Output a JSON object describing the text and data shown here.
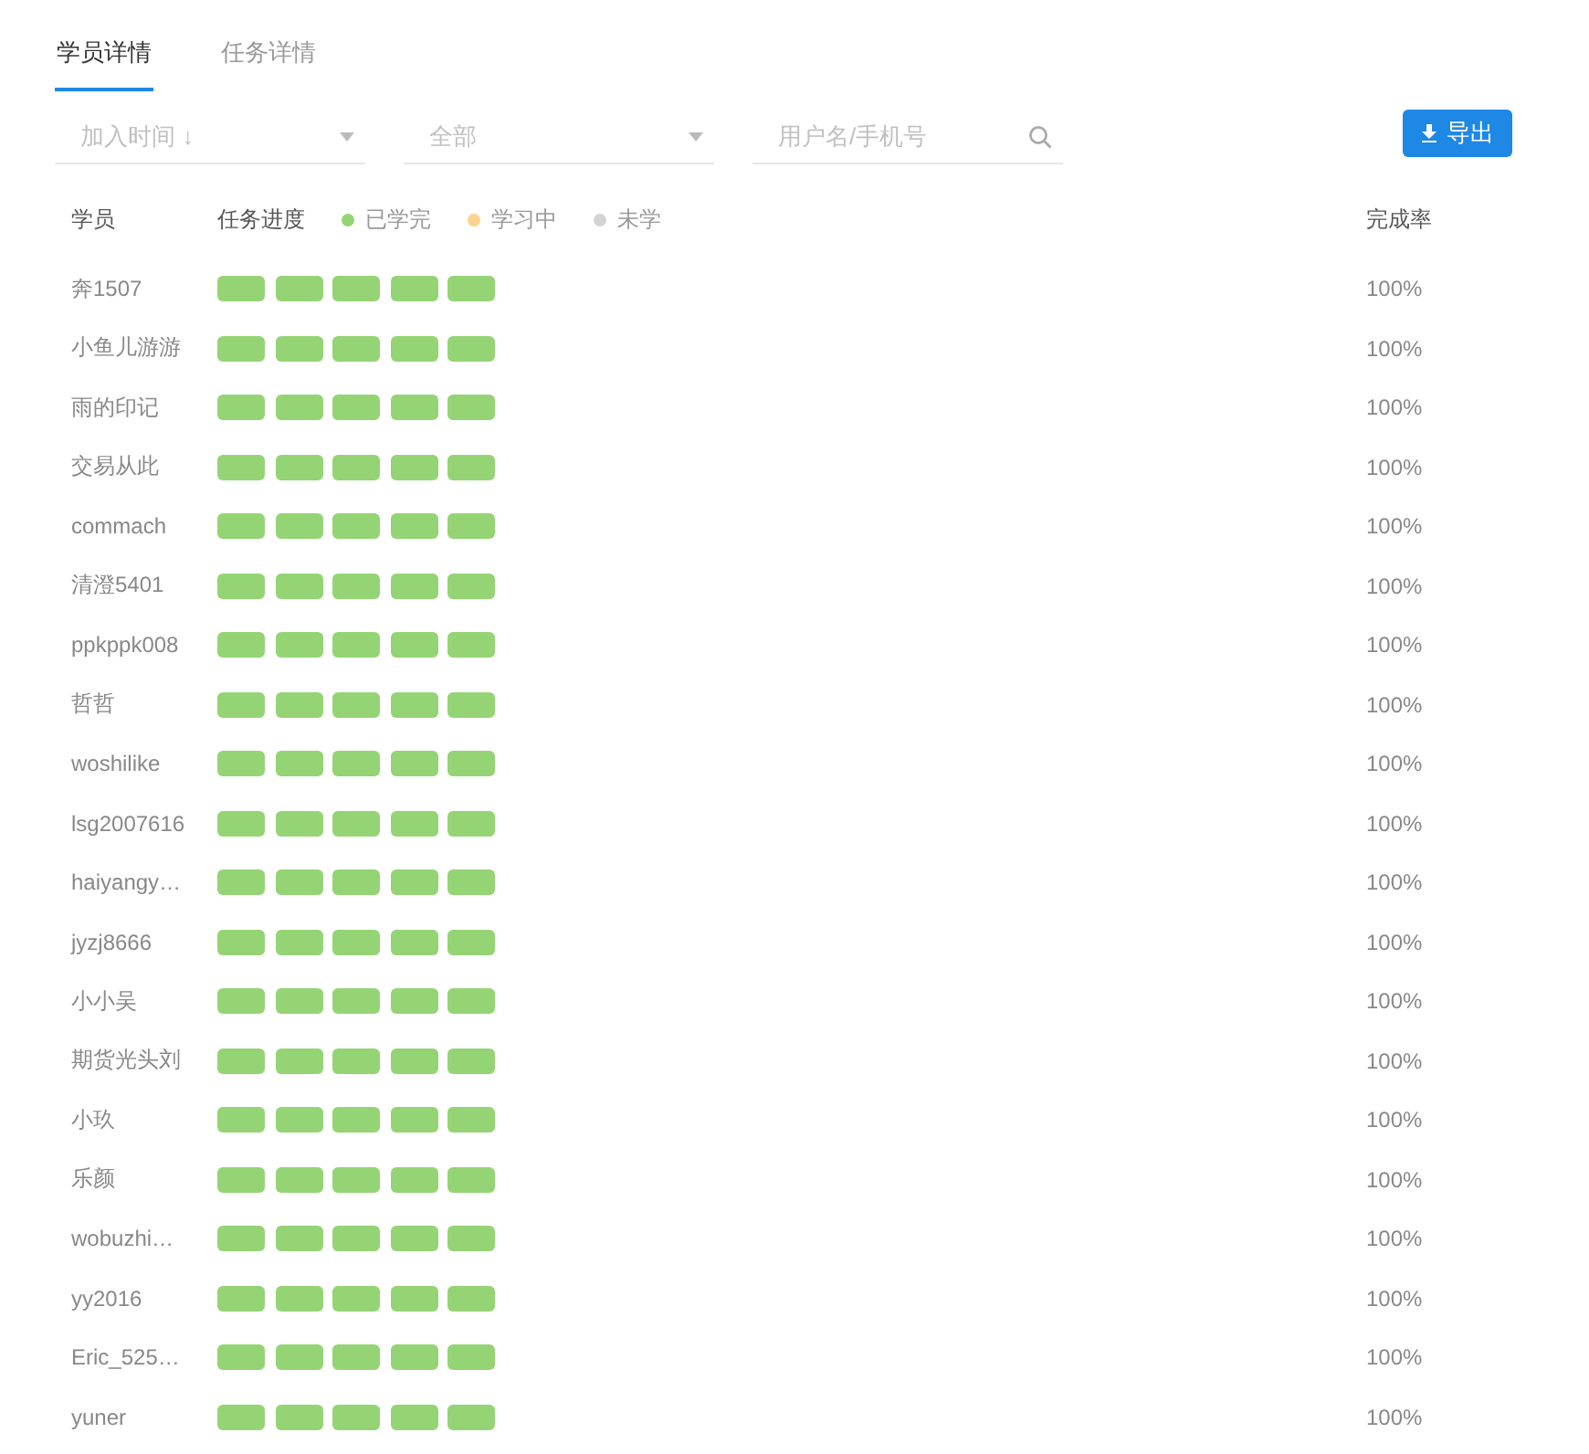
{
  "tabs": [
    {
      "label": "学员详情",
      "selected": true
    },
    {
      "label": "任务详情",
      "selected": false
    }
  ],
  "filters": [
    {
      "kind": "select",
      "placeholder": "加入时间 ↓"
    },
    {
      "kind": "select",
      "placeholder": "全部"
    },
    {
      "kind": "search",
      "placeholder": "用户名/手机号"
    }
  ],
  "export_button": "导出",
  "table": {
    "columns": [
      "学员",
      "任务进度",
      "完成率"
    ],
    "legend": [
      {
        "label": "已学完",
        "color": "#95d475"
      },
      {
        "label": "学习中",
        "color": "#fbd38d"
      },
      {
        "label": "未学",
        "color": "#d3d3d3"
      }
    ],
    "rows": [
      {
        "name": "奔1507",
        "tasks": [
          {
            "kind": "done"
          },
          {
            "kind": "done"
          },
          {
            "kind": "done"
          },
          {
            "kind": "done"
          },
          {
            "kind": "done"
          }
        ],
        "rate": "100%"
      },
      {
        "name": "小鱼儿游游",
        "tasks": [
          {
            "kind": "done"
          },
          {
            "kind": "done"
          },
          {
            "kind": "done"
          },
          {
            "kind": "done"
          },
          {
            "kind": "done"
          }
        ],
        "rate": "100%"
      },
      {
        "name": "雨的印记",
        "tasks": [
          {
            "kind": "done"
          },
          {
            "kind": "done"
          },
          {
            "kind": "done"
          },
          {
            "kind": "done"
          },
          {
            "kind": "done"
          }
        ],
        "rate": "100%"
      },
      {
        "name": "交易从此",
        "tasks": [
          {
            "kind": "done"
          },
          {
            "kind": "done"
          },
          {
            "kind": "done"
          },
          {
            "kind": "done"
          },
          {
            "kind": "done"
          }
        ],
        "rate": "100%"
      },
      {
        "name": "commach",
        "tasks": [
          {
            "kind": "done"
          },
          {
            "kind": "done"
          },
          {
            "kind": "done"
          },
          {
            "kind": "done"
          },
          {
            "kind": "done"
          }
        ],
        "rate": "100%"
      },
      {
        "name": "清澄5401",
        "tasks": [
          {
            "kind": "done"
          },
          {
            "kind": "done"
          },
          {
            "kind": "done"
          },
          {
            "kind": "done"
          },
          {
            "kind": "done"
          }
        ],
        "rate": "100%"
      },
      {
        "name": "ppkppk008",
        "tasks": [
          {
            "kind": "done"
          },
          {
            "kind": "done"
          },
          {
            "kind": "done"
          },
          {
            "kind": "done"
          },
          {
            "kind": "done"
          }
        ],
        "rate": "100%"
      },
      {
        "name": "哲哲",
        "tasks": [
          {
            "kind": "done"
          },
          {
            "kind": "done"
          },
          {
            "kind": "done"
          },
          {
            "kind": "done"
          },
          {
            "kind": "done"
          }
        ],
        "rate": "100%"
      },
      {
        "name": "woshilike",
        "tasks": [
          {
            "kind": "done"
          },
          {
            "kind": "done"
          },
          {
            "kind": "done"
          },
          {
            "kind": "done"
          },
          {
            "kind": "done"
          }
        ],
        "rate": "100%"
      },
      {
        "name": "lsg2007616",
        "tasks": [
          {
            "kind": "done"
          },
          {
            "kind": "done"
          },
          {
            "kind": "done"
          },
          {
            "kind": "done"
          },
          {
            "kind": "done"
          }
        ],
        "rate": "100%"
      },
      {
        "name": "haiyangy…",
        "tasks": [
          {
            "kind": "done"
          },
          {
            "kind": "done"
          },
          {
            "kind": "done"
          },
          {
            "kind": "done"
          },
          {
            "kind": "done"
          }
        ],
        "rate": "100%"
      },
      {
        "name": "jyzj8666",
        "tasks": [
          {
            "kind": "done"
          },
          {
            "kind": "done"
          },
          {
            "kind": "done"
          },
          {
            "kind": "done"
          },
          {
            "kind": "done"
          }
        ],
        "rate": "100%"
      },
      {
        "name": "小小吴",
        "tasks": [
          {
            "kind": "done"
          },
          {
            "kind": "done"
          },
          {
            "kind": "done"
          },
          {
            "kind": "done"
          },
          {
            "kind": "done"
          }
        ],
        "rate": "100%"
      },
      {
        "name": "期货光头刘",
        "tasks": [
          {
            "kind": "done"
          },
          {
            "kind": "done"
          },
          {
            "kind": "done"
          },
          {
            "kind": "done"
          },
          {
            "kind": "done"
          }
        ],
        "rate": "100%"
      },
      {
        "name": "小玖",
        "tasks": [
          {
            "kind": "done"
          },
          {
            "kind": "done"
          },
          {
            "kind": "done"
          },
          {
            "kind": "done"
          },
          {
            "kind": "done"
          }
        ],
        "rate": "100%"
      },
      {
        "name": "乐颜",
        "tasks": [
          {
            "kind": "done"
          },
          {
            "kind": "done"
          },
          {
            "kind": "done"
          },
          {
            "kind": "done"
          },
          {
            "kind": "done"
          }
        ],
        "rate": "100%"
      },
      {
        "name": "wobuzhi…",
        "tasks": [
          {
            "kind": "done"
          },
          {
            "kind": "done"
          },
          {
            "kind": "done"
          },
          {
            "kind": "done"
          },
          {
            "kind": "done"
          }
        ],
        "rate": "100%"
      },
      {
        "name": "yy2016",
        "tasks": [
          {
            "kind": "done"
          },
          {
            "kind": "done"
          },
          {
            "kind": "done"
          },
          {
            "kind": "done"
          },
          {
            "kind": "done"
          }
        ],
        "rate": "100%"
      },
      {
        "name": "Eric_525…",
        "tasks": [
          {
            "kind": "done"
          },
          {
            "kind": "done"
          },
          {
            "kind": "done"
          },
          {
            "kind": "done"
          },
          {
            "kind": "done"
          }
        ],
        "rate": "100%"
      },
      {
        "name": "yuner",
        "tasks": [
          {
            "kind": "done"
          },
          {
            "kind": "done"
          },
          {
            "kind": "done"
          },
          {
            "kind": "done"
          },
          {
            "kind": "done"
          }
        ],
        "rate": "100%"
      }
    ]
  }
}
